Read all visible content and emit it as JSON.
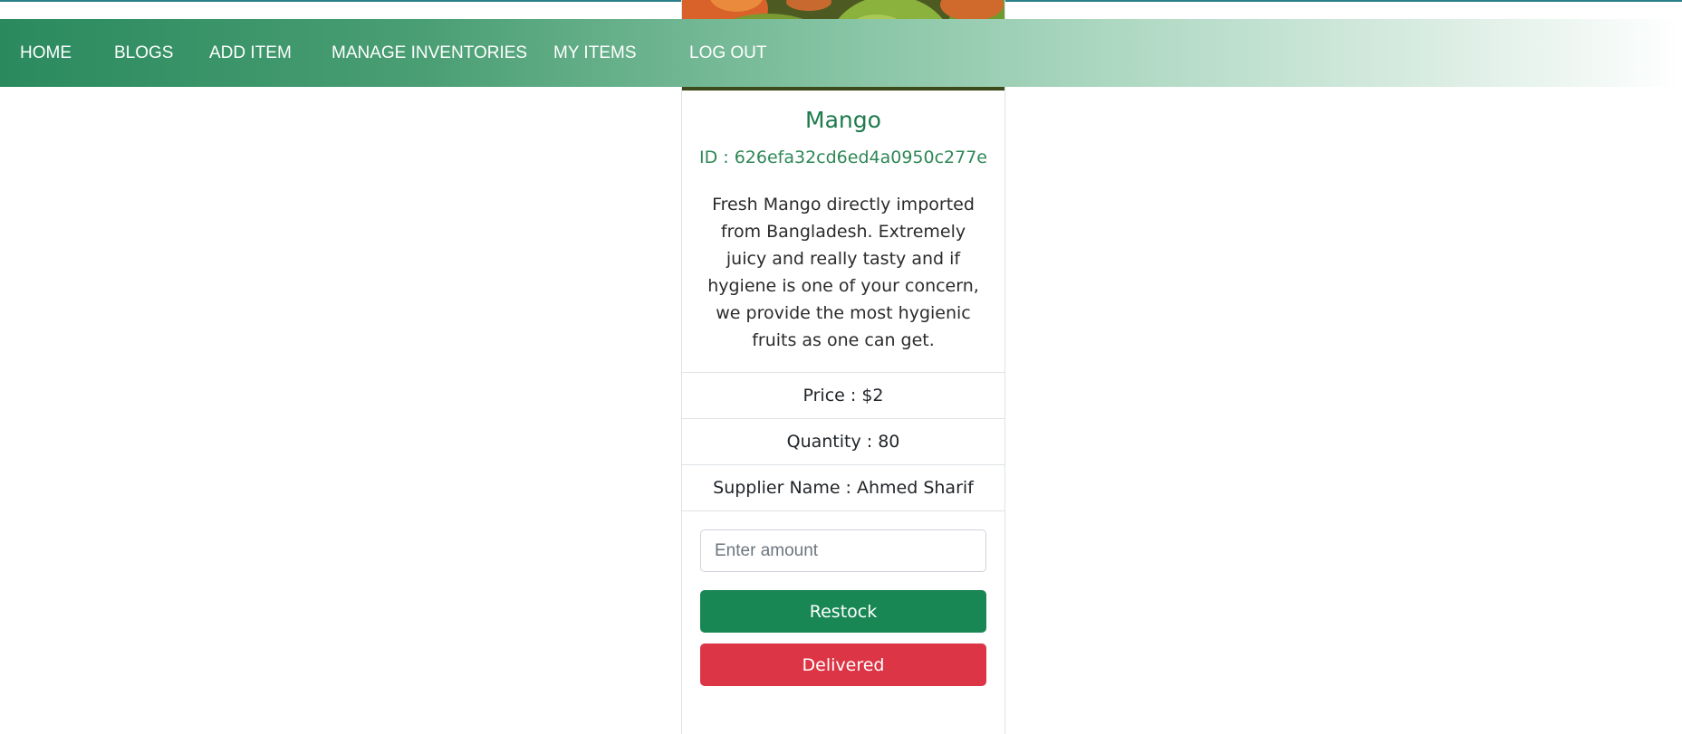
{
  "nav": {
    "items": [
      {
        "label": "HOME"
      },
      {
        "label": "BLOGS"
      },
      {
        "label": "ADD ITEM"
      },
      {
        "label": "MANAGE INVENTORIES"
      },
      {
        "label": "MY ITEMS"
      },
      {
        "label": "LOG OUT"
      }
    ]
  },
  "item": {
    "image_icon": "mango-photo",
    "name": "Mango",
    "id_text": "ID : 626efa32cd6ed4a0950c277e",
    "description": "Fresh Mango directly imported from Bangladesh. Extremely juicy and really tasty and if hygiene is one of your concern, we provide the most hygienic fruits as one can get.",
    "price_text": "Price : $2",
    "quantity_text": "Quantity : 80",
    "supplier_text": "Supplier Name : Ahmed Sharif"
  },
  "form": {
    "amount_placeholder": "Enter amount",
    "amount_value": "",
    "restock_label": "Restock",
    "delivered_label": "Delivered"
  },
  "colors": {
    "primary_green": "#198754",
    "danger_red": "#dc3545",
    "title_green": "#1f7a4c"
  }
}
